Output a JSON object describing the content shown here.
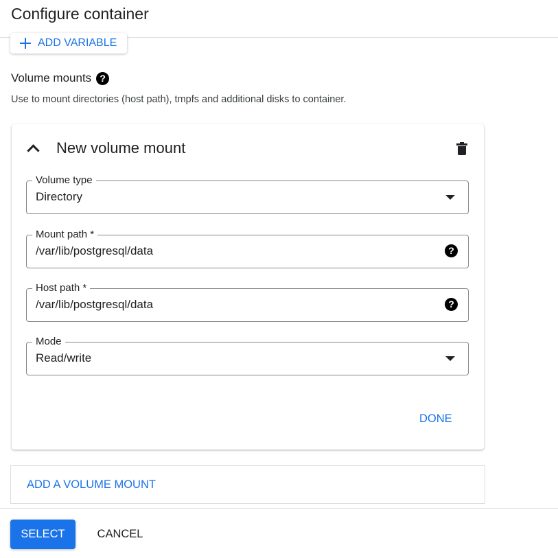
{
  "header": {
    "title": "Configure container"
  },
  "variables": {
    "add_label": "ADD VARIABLE"
  },
  "volume_mounts": {
    "heading": "Volume mounts",
    "description": "Use to mount directories (host path), tmpfs and additional disks to container."
  },
  "card": {
    "title": "New volume mount",
    "fields": {
      "volume_type": {
        "label": "Volume type",
        "value": "Directory"
      },
      "mount_path": {
        "label": "Mount path *",
        "value": "/var/lib/postgresql/data"
      },
      "host_path": {
        "label": "Host path *",
        "value": "/var/lib/postgresql/data"
      },
      "mode": {
        "label": "Mode",
        "value": "Read/write"
      }
    },
    "done_label": "DONE"
  },
  "add_volume_label": "ADD A VOLUME MOUNT",
  "footer": {
    "select_label": "SELECT",
    "cancel_label": "CANCEL"
  },
  "icons": {
    "help": "?",
    "add": "plus-icon",
    "delete": "trash-icon",
    "collapse": "chevron-up-icon",
    "dropdown": "dropdown-arrow-icon"
  },
  "colors": {
    "accent": "#1a73e8",
    "text": "#202124",
    "border": "#dadce0"
  }
}
